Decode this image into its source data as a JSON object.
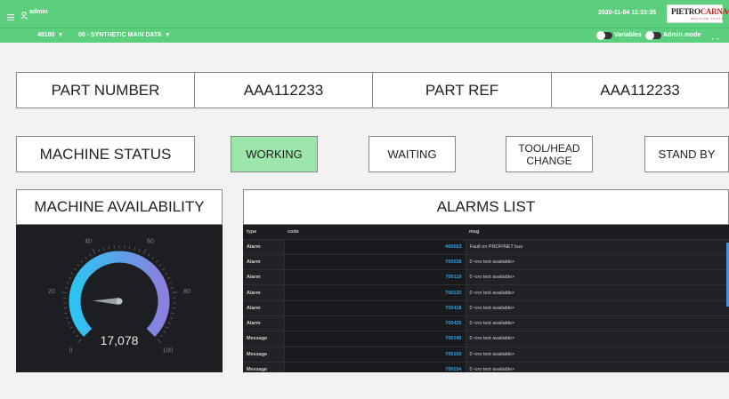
{
  "topbar": {
    "user": "admin",
    "datetime": "2020-11-04 11:33:35"
  },
  "brand": {
    "logo_main_a": "PIETRO",
    "logo_main_b": "CARNAGHI",
    "logo_sub": "MACHINE TOOLS"
  },
  "subbar": {
    "machine_select": "48180",
    "data_select": "00 - SYNTHETIC MAIN DATA",
    "variables_label": "Variables",
    "admin_label": "Admin mode"
  },
  "part": {
    "number_label": "PART NUMBER",
    "number_value": "AAA112233",
    "ref_label": "PART REF",
    "ref_value": "AAA112233"
  },
  "status": {
    "label": "MACHINE STATUS",
    "working": "WORKING",
    "waiting": "WAITING",
    "tool_head_1": "TOOL/HEAD",
    "tool_head_2": "CHANGE",
    "standby": "STAND BY",
    "active": "WORKING"
  },
  "availability": {
    "title": "MACHINE AVAILABILITY",
    "value_text": "17,078",
    "value": 17.078,
    "min": 0,
    "max": 100,
    "ticks": [
      "0",
      "20",
      "40",
      "60",
      "80",
      "100"
    ]
  },
  "alarms": {
    "title": "ALARMS LIST",
    "columns": [
      "type",
      "code",
      "msg"
    ],
    "rows": [
      {
        "type": "Alarm",
        "code": "400553",
        "msg": "Fault on PROFINET bus"
      },
      {
        "type": "Alarm",
        "code": "700028",
        "msg": "0 <no text available>"
      },
      {
        "type": "Alarm",
        "code": "700119",
        "msg": "0 <no text available>"
      },
      {
        "type": "Alarm",
        "code": "700120",
        "msg": "0 <no text available>"
      },
      {
        "type": "Alarm",
        "code": "700418",
        "msg": "0 <no text available>"
      },
      {
        "type": "Alarm",
        "code": "700425",
        "msg": "0 <no text available>"
      },
      {
        "type": "Message",
        "code": "700145",
        "msg": "0 <no text available>"
      },
      {
        "type": "Message",
        "code": "700150",
        "msg": "0 <no text available>"
      },
      {
        "type": "Message",
        "code": "700154",
        "msg": "0 <no text available>"
      }
    ]
  },
  "colors": {
    "accent": "#5ccf7f",
    "active_status": "#9ce5ab",
    "gauge_start": "#2ec4f2",
    "gauge_end": "#8b7fe0"
  },
  "icons": [
    "menu-icon",
    "user-icon",
    "chevron-down-icon",
    "fullscreen-icon"
  ]
}
